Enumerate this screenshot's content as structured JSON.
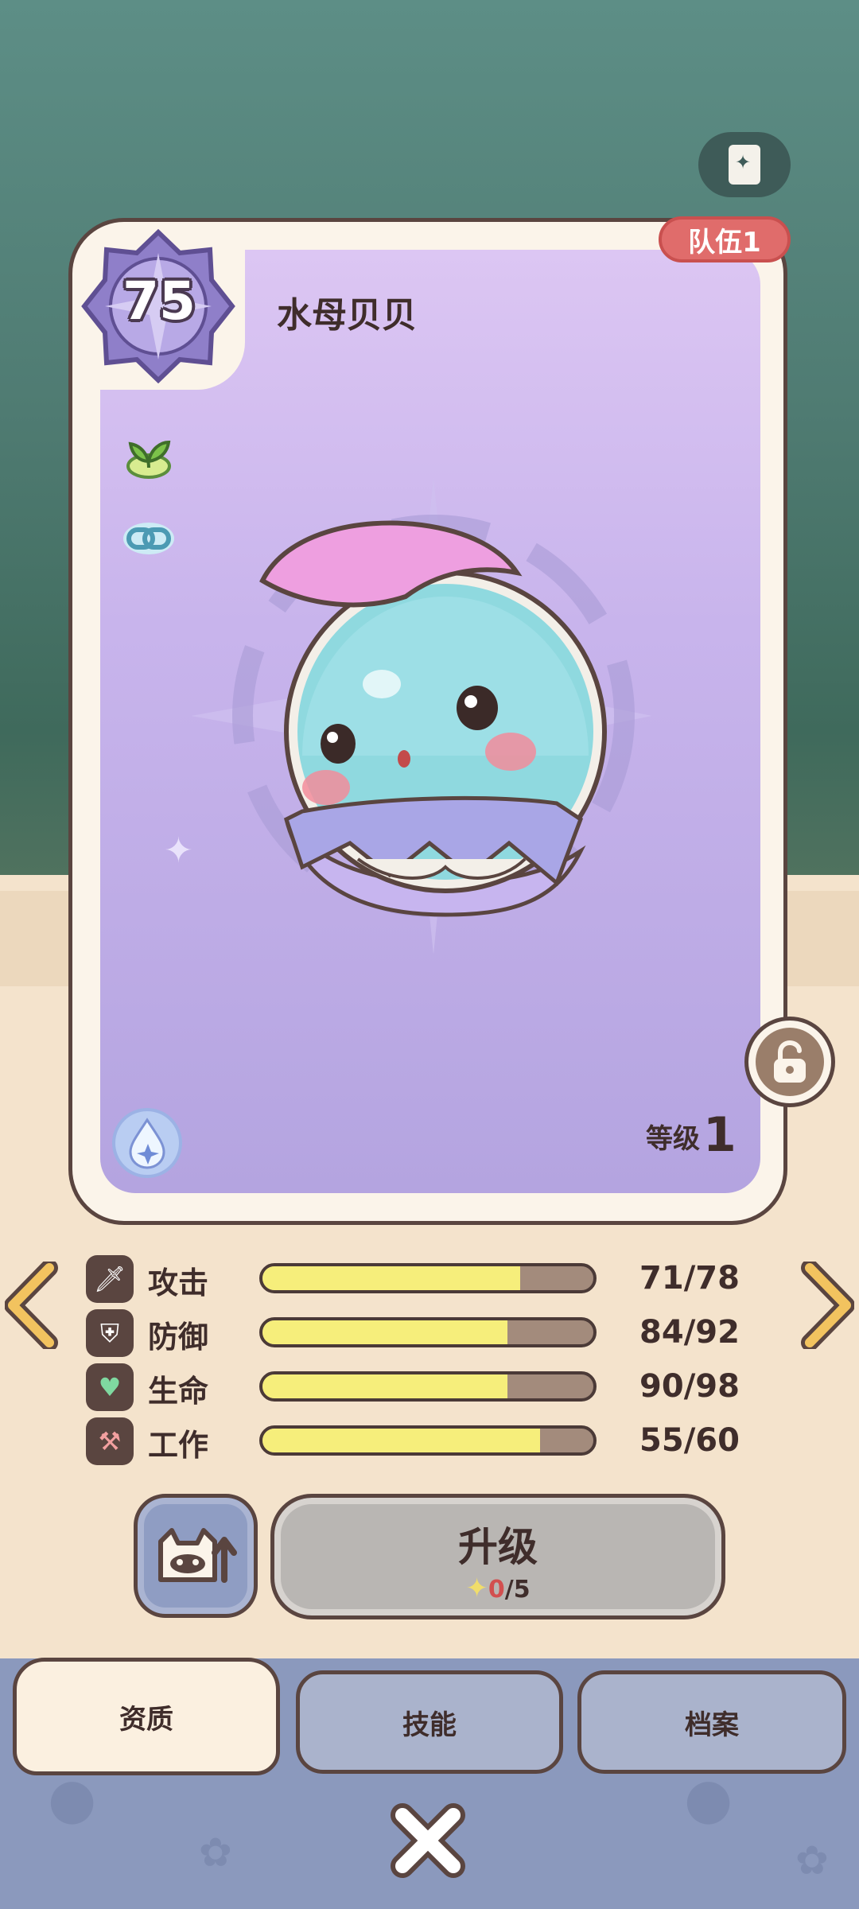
{
  "card": {
    "team_badge": "队伍1",
    "level": "75",
    "name": "水母贝贝",
    "grade_label": "等级",
    "grade_value": "1",
    "traits": [
      "sprout-icon",
      "link-icon"
    ],
    "element": "water-element-icon"
  },
  "stats": [
    {
      "icon": "sword-icon",
      "label": "攻击",
      "value": "71/78",
      "fill": 0.78
    },
    {
      "icon": "shield-icon",
      "label": "防御",
      "value": "84/92",
      "fill": 0.74
    },
    {
      "icon": "heart-up-icon",
      "label": "生命",
      "value": "90/98",
      "fill": 0.74
    },
    {
      "icon": "hammer-down-icon",
      "label": "工作",
      "value": "55/60",
      "fill": 0.84
    }
  ],
  "upgrade": {
    "label": "升级",
    "cost_have": "0",
    "cost_need": "/5"
  },
  "tabs": [
    {
      "label": "资质",
      "active": true
    },
    {
      "label": "技能",
      "active": false
    },
    {
      "label": "档案",
      "active": false
    }
  ],
  "colors": {
    "bar_fill": "#f6ee7b",
    "bar_empty": "#a38b7c",
    "team_badge": "#e06c6b",
    "card_purple": "#c8b4ec"
  }
}
